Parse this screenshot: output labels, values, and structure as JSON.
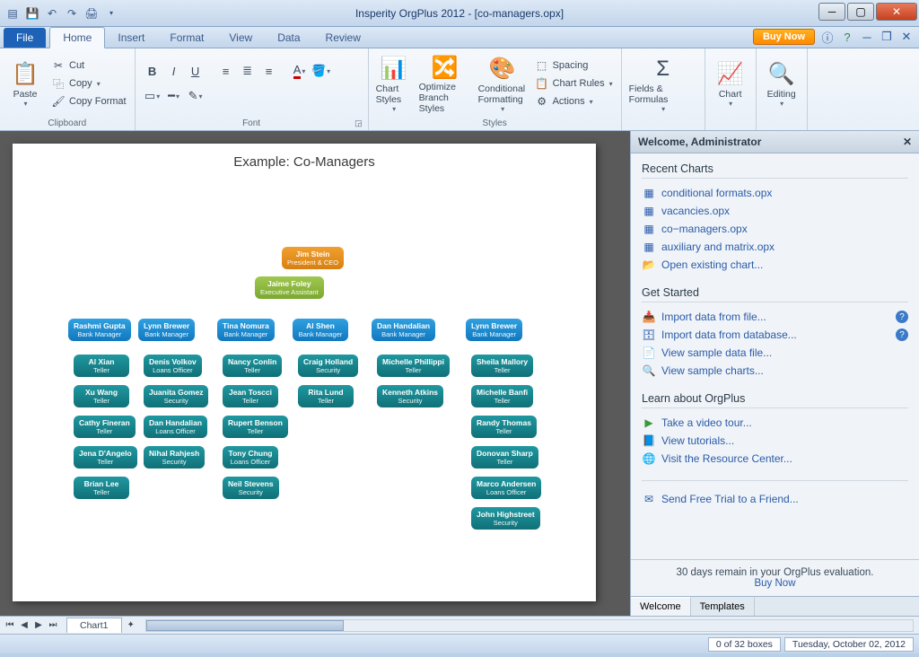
{
  "titlebar": {
    "title": "Insperity OrgPlus 2012 - [co-managers.opx]"
  },
  "tabs": {
    "file": "File",
    "items": [
      "Home",
      "Insert",
      "Format",
      "View",
      "Data",
      "Review"
    ],
    "active": 0,
    "buy": "Buy Now"
  },
  "ribbon": {
    "clipboard": {
      "label": "Clipboard",
      "paste": "Paste",
      "cut": "Cut",
      "copy": "Copy",
      "copyformat": "Copy Format"
    },
    "font": {
      "label": "Font"
    },
    "styles": {
      "label": "Styles",
      "chartstyles": "Chart Styles",
      "optimize": "Optimize Branch Styles",
      "conditional": "Conditional Formatting",
      "spacing": "Spacing",
      "chartrules": "Chart Rules",
      "actions": "Actions"
    },
    "fields": {
      "label": "Fields & Formulas"
    },
    "chart": {
      "label": "Chart"
    },
    "editing": {
      "label": "Editing"
    }
  },
  "canvas": {
    "title": "Example: Co-Managers"
  },
  "chart_data": {
    "type": "org",
    "root": {
      "name": "Jim Stein",
      "role": "President & CEO",
      "color": "orange"
    },
    "assistant": {
      "name": "Jaime Foley",
      "role": "Executive Assistant",
      "color": "green"
    },
    "managers": [
      {
        "name": "Rashmi Gupta",
        "role": "Bank Manager",
        "reports": [
          {
            "name": "Al Xian",
            "role": "Teller"
          },
          {
            "name": "Xu Wang",
            "role": "Teller"
          },
          {
            "name": "Cathy Fineran",
            "role": "Teller"
          },
          {
            "name": "Jena D'Angelo",
            "role": "Teller"
          },
          {
            "name": "Brian Lee",
            "role": "Teller"
          }
        ]
      },
      {
        "name": "Lynn Brewer",
        "role": "Bank Manager",
        "reports": [
          {
            "name": "Denis Volkov",
            "role": "Loans Officer"
          },
          {
            "name": "Juanita Gomez",
            "role": "Security"
          },
          {
            "name": "Dan Handalian",
            "role": "Loans Officer"
          },
          {
            "name": "Nihal Rahjesh",
            "role": "Security"
          }
        ]
      },
      {
        "name": "Tina Nomura",
        "role": "Bank Manager",
        "reports": [
          {
            "name": "Nancy Conlin",
            "role": "Teller"
          },
          {
            "name": "Jean Toscci",
            "role": "Teller"
          },
          {
            "name": "Rupert Benson",
            "role": "Teller"
          },
          {
            "name": "Tony Chung",
            "role": "Loans Officer"
          },
          {
            "name": "Neil Stevens",
            "role": "Security"
          }
        ]
      },
      {
        "name": "Al Shen",
        "role": "Bank Manager",
        "reports": [
          {
            "name": "Craig Holland",
            "role": "Security"
          },
          {
            "name": "Rita Lund",
            "role": "Teller"
          }
        ]
      },
      {
        "name": "Dan Handalian",
        "role": "Bank Manager",
        "reports": [
          {
            "name": "Michelle Phillippi",
            "role": "Teller"
          },
          {
            "name": "Kenneth Atkins",
            "role": "Security"
          }
        ]
      },
      {
        "name": "Lynn Brewer",
        "role": "Bank Manager",
        "reports": [
          {
            "name": "Sheila Mallory",
            "role": "Teller"
          },
          {
            "name": "Michelle Banfi",
            "role": "Teller"
          },
          {
            "name": "Randy Thomas",
            "role": "Teller"
          },
          {
            "name": "Donovan Sharp",
            "role": "Teller"
          },
          {
            "name": "Marco Andersen",
            "role": "Loans Officer"
          },
          {
            "name": "John Highstreet",
            "role": "Security"
          }
        ]
      }
    ]
  },
  "side": {
    "header": "Welcome, Administrator",
    "recent": {
      "title": "Recent Charts",
      "items": [
        "conditional formats.opx",
        "vacancies.opx",
        "co−managers.opx",
        "auxiliary and matrix.opx"
      ],
      "open": "Open existing chart..."
    },
    "start": {
      "title": "Get Started",
      "importfile": "Import data from file...",
      "importdb": "Import data from database...",
      "sampledata": "View sample data file...",
      "samplecharts": "View sample charts..."
    },
    "learn": {
      "title": "Learn about OrgPlus",
      "video": "Take a video tour...",
      "tutorials": "View tutorials...",
      "resource": "Visit the Resource Center..."
    },
    "sendtrial": "Send Free Trial to a Friend...",
    "eval": "30 days remain in your OrgPlus evaluation.",
    "buynow": "Buy Now",
    "tabs": [
      "Welcome",
      "Templates"
    ]
  },
  "sheet": {
    "tab": "Chart1"
  },
  "status": {
    "boxes": "0 of 32 boxes",
    "date": "Tuesday, October 02, 2012"
  }
}
